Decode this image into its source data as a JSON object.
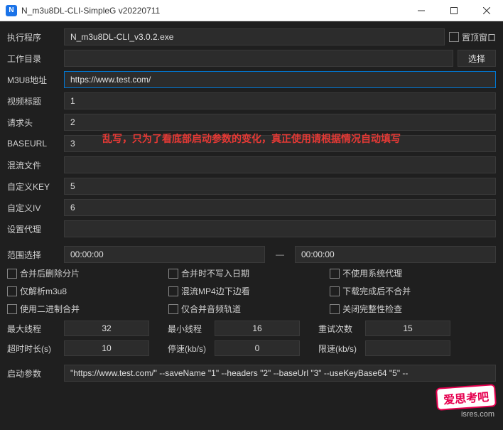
{
  "window": {
    "title": "N_m3u8DL-CLI-SimpleG v20220711"
  },
  "labels": {
    "exec": "执行程序",
    "workdir": "工作目录",
    "m3u8": "M3U8地址",
    "title": "视频标题",
    "reqhead": "请求头",
    "baseurl": "BASEURL",
    "muxset": "混流文件",
    "key": "自定义KEY",
    "iv": "自定义IV",
    "proxy": "设置代理",
    "range": "范围选择",
    "maxthread": "最大线程",
    "minthread": "最小线程",
    "retry": "重试次数",
    "timeout": "超时时长(s)",
    "stopspeed": "停速(kb/s)",
    "maxspeed": "限速(kb/s)",
    "startargs": "启动参数"
  },
  "values": {
    "exec": "N_m3u8DL-CLI_v3.0.2.exe",
    "workdir": "",
    "m3u8": "https://www.test.com/",
    "title": "1",
    "reqhead": "2",
    "baseurl": "3",
    "muxset": "",
    "key": "5",
    "iv": "6",
    "proxy": "",
    "range_from": "00:00:00",
    "range_to": "00:00:00",
    "maxthread": "32",
    "minthread": "16",
    "retry": "15",
    "timeout": "10",
    "stopspeed": "0",
    "maxspeed": "",
    "startargs": "\"https://www.test.com/\" --saveName \"1\" --headers \"2\" --baseUrl \"3\" --useKeyBase64 \"5\" --"
  },
  "buttons": {
    "topmost": "置顶窗口",
    "choose": "选择"
  },
  "checkboxes": {
    "c1": "合并后删除分片",
    "c2": "合并时不写入日期",
    "c3": "不使用系统代理",
    "c4": "仅解析m3u8",
    "c5": "混流MP4边下边看",
    "c6": "下载完成后不合并",
    "c7": "使用二进制合并",
    "c8": "仅合并音频轨道",
    "c9": "关闭完整性检查"
  },
  "overlay": "乱写，只为了看底部启动参数的变化，真正使用请根据情况自动填写",
  "watermark": {
    "stamp": "爱思考吧",
    "sub": "isres.com"
  }
}
